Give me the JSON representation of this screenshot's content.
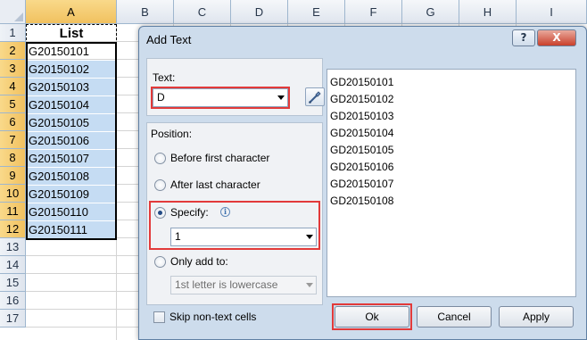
{
  "spreadsheet": {
    "columns": [
      "A",
      "B",
      "C",
      "D",
      "E",
      "F",
      "G",
      "H",
      "I"
    ],
    "rows": [
      "1",
      "2",
      "3",
      "4",
      "5",
      "6",
      "7",
      "8",
      "9",
      "10",
      "11",
      "12",
      "13",
      "14",
      "15",
      "16",
      "17"
    ],
    "header_cell": "List",
    "cells": [
      "G20150101",
      "G20150102",
      "G20150103",
      "G20150104",
      "G20150105",
      "G20150106",
      "G20150107",
      "G20150108",
      "G20150109",
      "G20150110",
      "G20150111"
    ],
    "selection_color": "#c5dcf3",
    "header_highlight_color": "#f1c15f"
  },
  "dialog": {
    "title": "Add Text",
    "help_label": "?",
    "close_label": "X",
    "text_label": "Text:",
    "text_value": "D",
    "position_label": "Position:",
    "options": {
      "before": "Before first character",
      "after": "After last character",
      "specify": "Specify:",
      "only_add": "Only add to:"
    },
    "selected_option": "specify",
    "specify_value": "1",
    "only_add_value": "1st letter is lowercase",
    "skip_label": "Skip non-text cells",
    "preview": [
      "GD20150101",
      "GD20150102",
      "GD20150103",
      "GD20150104",
      "GD20150105",
      "GD20150106",
      "GD20150107",
      "GD20150108"
    ],
    "buttons": {
      "ok": "Ok",
      "cancel": "Cancel",
      "apply": "Apply"
    },
    "highlight_color": "#e23a3a"
  }
}
